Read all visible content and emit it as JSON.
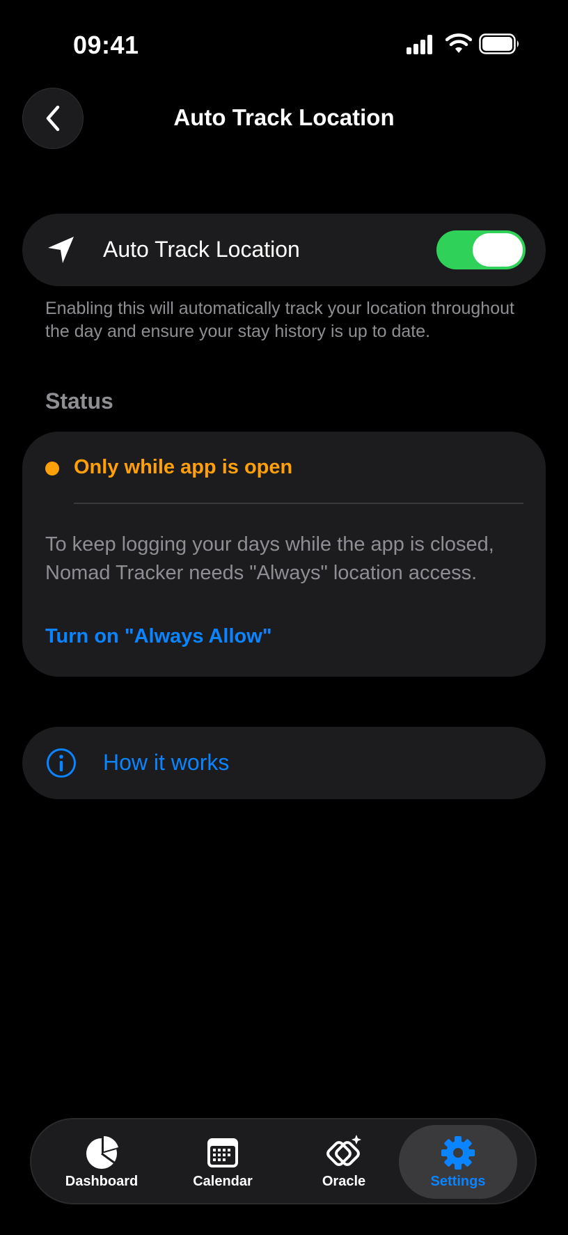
{
  "status_bar": {
    "time": "09:41"
  },
  "header": {
    "title": "Auto Track Location"
  },
  "toggle_row": {
    "label": "Auto Track Location",
    "enabled": true
  },
  "description": "Enabling this will automatically track your location throughout the day and ensure your stay history is up to date.",
  "status_section": {
    "header": "Status",
    "state": "Only while app is open",
    "body": "To keep logging your days while the app is closed, Nomad Tracker needs \"Always\" location access.",
    "link": "Turn on \"Always Allow\""
  },
  "how_it_works": {
    "label": "How it works"
  },
  "tab_bar": {
    "tabs": [
      {
        "label": "Dashboard",
        "icon": "pie-chart-icon"
      },
      {
        "label": "Calendar",
        "icon": "calendar-icon"
      },
      {
        "label": "Oracle",
        "icon": "oracle-sparkle-icon"
      },
      {
        "label": "Settings",
        "icon": "gear-icon",
        "active": true
      }
    ]
  },
  "colors": {
    "accent": "#0a84ff",
    "toggle_on": "#30d158",
    "warning": "#ff9f0a"
  }
}
